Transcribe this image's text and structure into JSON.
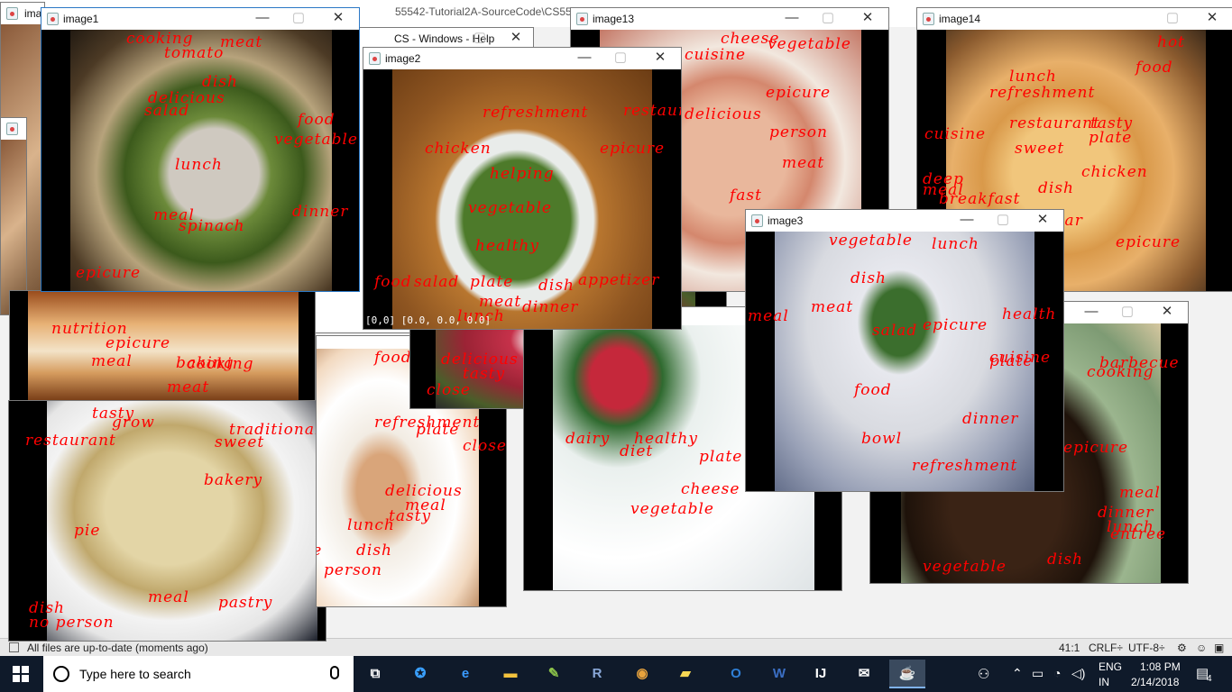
{
  "ide": {
    "title_fragment": "55542-Tutorial2A-SourceCode\\CS5542-Tutorial2A-SourceCode\\Image-Annotation\\Clarifai\\...\\src\\...",
    "status_message": "All files are up-to-date (moments ago)",
    "cursor_position": "41:1",
    "line_separator": "CRLF÷",
    "encoding": "UTF-8÷"
  },
  "windows": [
    {
      "id": "image1",
      "title": "image1",
      "active": true,
      "photo": "ph-bibim",
      "labels": [
        "cooking",
        "meat",
        "tomato",
        "dish",
        "delicious",
        "salad",
        "food",
        "vegetable",
        "lunch",
        "dinner",
        "meal",
        "spinach",
        "epicure"
      ]
    },
    {
      "id": "image2",
      "title": "image2",
      "photo": "ph-caesar",
      "pixel_info": "[0,0] [0.0, 0.0, 0.0]",
      "labels": [
        "refreshment",
        "restaurant",
        "chicken",
        "epicure",
        "helping",
        "vegetable",
        "healthy",
        "food",
        "salad",
        "plate",
        "dish",
        "appetizer",
        "lunch",
        "meat",
        "dinner"
      ]
    },
    {
      "id": "image13",
      "title": "image13",
      "photo": "ph-pizza",
      "labels": [
        "cheese",
        "vegetable",
        "cuisine",
        "epicure",
        "delicious",
        "person",
        "meat",
        "fast"
      ]
    },
    {
      "id": "image14",
      "title": "image14",
      "photo": "ph-dough",
      "labels": [
        "hot",
        "food",
        "lunch",
        "refreshment",
        "restaurant",
        "tasty",
        "plate",
        "cuisine",
        "sweet",
        "chicken",
        "deep",
        "meal",
        "dish",
        "breakfast",
        "sugar",
        "epicure"
      ]
    },
    {
      "id": "image3",
      "title": "image3",
      "photo": "ph-salad3",
      "labels": [
        "vegetable",
        "lunch",
        "dish",
        "meat",
        "salad",
        "epicure",
        "food",
        "dinner",
        "bowl",
        "refreshment",
        "cuisine",
        "plate",
        "meal",
        "health"
      ]
    },
    {
      "id": "unknown-cannoli",
      "photo": "ph-cannoli",
      "labels": [
        "nutrition",
        "epicure",
        "meal",
        "baking",
        "cooking",
        "meat"
      ]
    },
    {
      "id": "unknown-baklava",
      "photo": "ph-baklava",
      "labels": [
        "tasty",
        "grow",
        "traditional",
        "restaurant",
        "sweet",
        "bakery",
        "pie",
        "dish",
        "meal",
        "pastry",
        "no person"
      ]
    },
    {
      "id": "unknown-dessert",
      "photo": "ph-dessert",
      "labels": [
        "food",
        "refreshment",
        "plate",
        "delicious",
        "meal",
        "tasty",
        "lunch",
        "plate",
        "dish",
        "person",
        "close"
      ]
    },
    {
      "id": "unknown-tuna",
      "photo": "ph-tuna",
      "labels": [
        "delicious",
        "tasty",
        "close",
        "food"
      ]
    },
    {
      "id": "unknown-caprese",
      "photo": "ph-caprese",
      "labels": [
        "dairy",
        "healthy",
        "diet",
        "plate",
        "cheese",
        "vegetable"
      ]
    },
    {
      "id": "unknown-bbq",
      "photo": "ph-bbq",
      "labels": [
        "barbecue",
        "cooking",
        "epicure",
        "meal",
        "dinner",
        "lunch",
        "entree",
        "vegetable",
        "dish"
      ]
    }
  ],
  "taskbar": {
    "search_placeholder": "Type here to search",
    "language": "ENG",
    "region": "IN",
    "time": "1:08 PM",
    "date": "2/14/2018",
    "notification_count": "4",
    "apps": [
      "task-view",
      "safari",
      "edge",
      "file-explorer",
      "notepadplusplus",
      "r",
      "chrome",
      "sticky-notes",
      "outlook",
      "word",
      "intellij",
      "mail",
      "java"
    ]
  }
}
